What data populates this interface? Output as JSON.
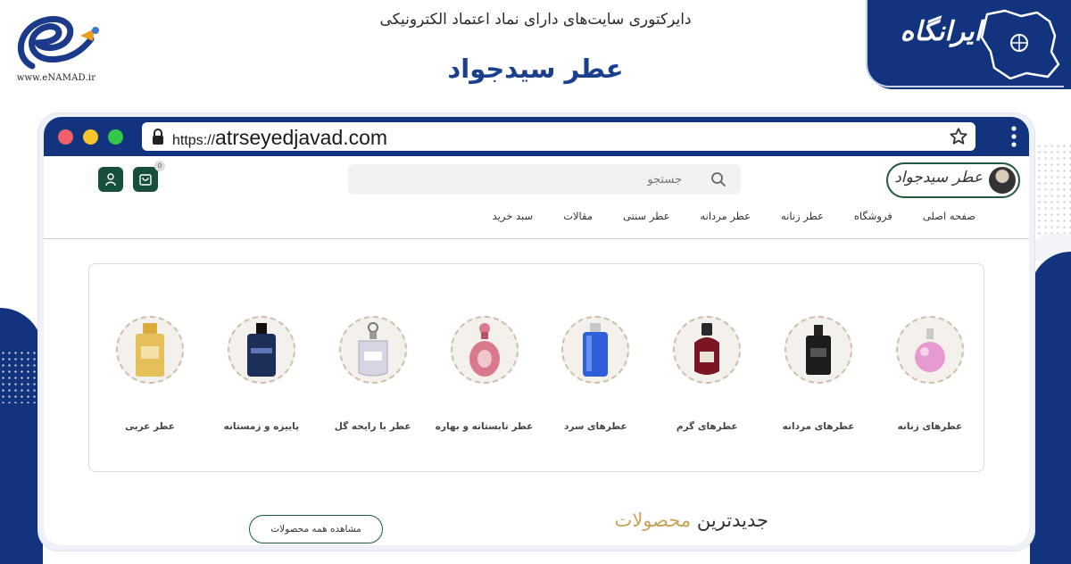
{
  "banner": {
    "enamad_domain": "www.eNAMAD.ir",
    "subtitle": "دایرکتوری سایت‌های دارای نماد اعتماد الکترونیکی",
    "site_name": "عطر سیدجواد",
    "irangah_label": "ایرانگاه",
    "brand_color": "#12347e"
  },
  "browser": {
    "url_scheme": "https://",
    "url_host": "atrseyedjavad.com",
    "window_dots": [
      "close",
      "minimize",
      "maximize"
    ]
  },
  "site": {
    "logo_text": "عطر سیدجواد",
    "search_placeholder": "جستجو",
    "cart_count": "0",
    "nav": [
      "صفحه اصلی",
      "فروشگاه",
      "عطر زنانه",
      "عطر مردانه",
      "عطر سنتی",
      "مقالات",
      "سبد خرید"
    ],
    "accent_green": "#17503a",
    "accent_gold": "#c8a25a"
  },
  "categories": [
    {
      "label": "عطرهای زنانه",
      "bottle": "pink-round-bottle-icon",
      "color": "#e79ad0"
    },
    {
      "label": "عطرهای مردانه",
      "bottle": "black-square-bottle-icon",
      "color": "#1c1c1c"
    },
    {
      "label": "عطرهای گرم",
      "bottle": "red-round-bottle-icon",
      "color": "#7a1622"
    },
    {
      "label": "عطرهای سرد",
      "bottle": "blue-tall-bottle-icon",
      "color": "#2f5fd8"
    },
    {
      "label": "عطر تابستانه و بهاره",
      "bottle": "ornate-pink-bottle-icon",
      "color": "#d97a8c"
    },
    {
      "label": "عطر با رایحه گل",
      "bottle": "clear-bottle-icon",
      "color": "#d9d4e3"
    },
    {
      "label": "پاییزه و زمستانه",
      "bottle": "navy-bottle-icon",
      "color": "#1d2e58"
    },
    {
      "label": "عطر عربی",
      "bottle": "gold-bottle-icon",
      "color": "#e4bf5a"
    }
  ],
  "newest": {
    "title_plain": "جدیدترین",
    "title_accent": "محصولات",
    "view_all": "مشاهده همه محصولات"
  }
}
